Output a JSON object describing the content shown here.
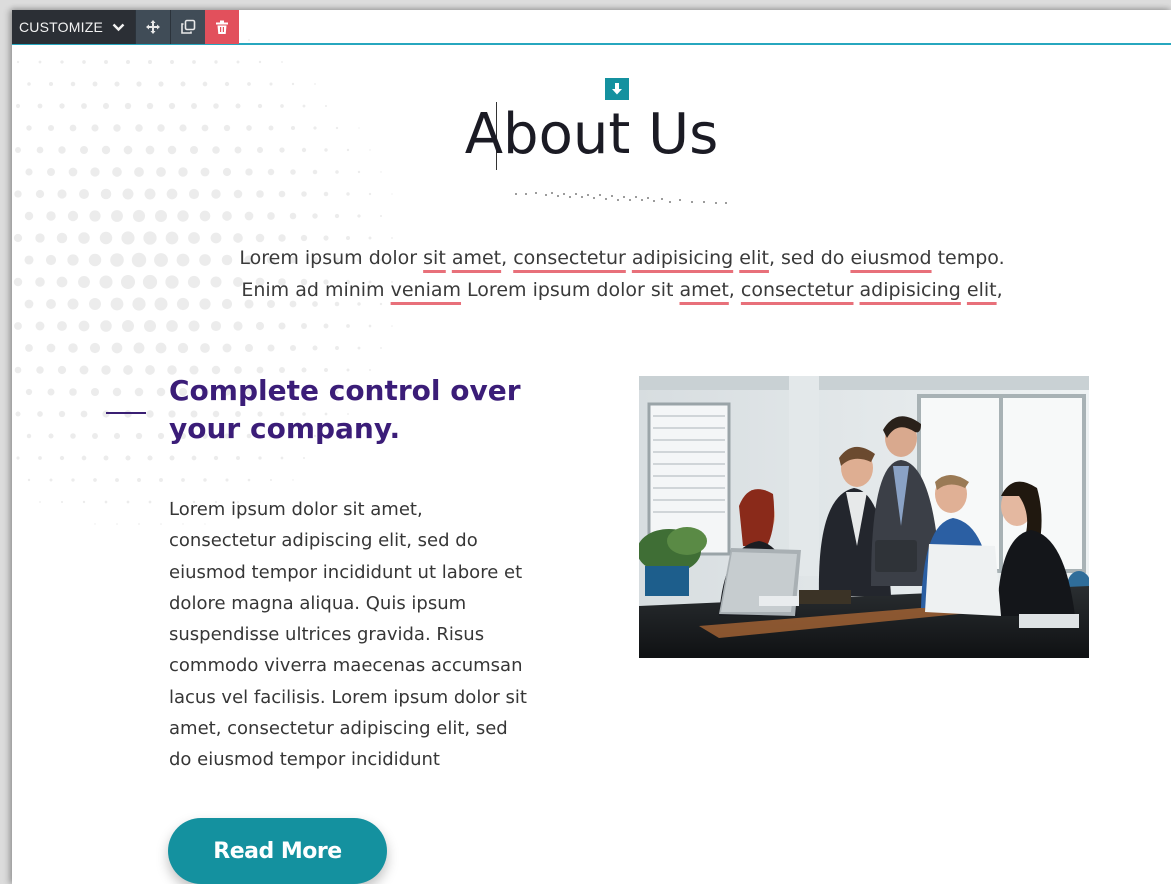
{
  "toolbar": {
    "customize_label": "CUSTOMIZE",
    "icons": [
      "chevron-down-icon",
      "move-icon",
      "duplicate-icon",
      "trash-icon"
    ]
  },
  "section": {
    "title": "About Us",
    "intro_line1": [
      {
        "t": "Lorem ipsum dolor ",
        "sp": false
      },
      {
        "t": "sit",
        "sp": true
      },
      {
        "t": " ",
        "sp": false
      },
      {
        "t": "amet",
        "sp": true
      },
      {
        "t": ", ",
        "sp": false
      },
      {
        "t": "consectetur",
        "sp": true
      },
      {
        "t": " ",
        "sp": false
      },
      {
        "t": "adipisicing",
        "sp": true
      },
      {
        "t": " ",
        "sp": false
      },
      {
        "t": "elit",
        "sp": true
      },
      {
        "t": ", sed do ",
        "sp": false
      },
      {
        "t": "eiusmod",
        "sp": true
      },
      {
        "t": " tempo.",
        "sp": false
      }
    ],
    "intro_line2": [
      {
        "t": "Enim ad minim ",
        "sp": false
      },
      {
        "t": "veniam",
        "sp": true
      },
      {
        "t": " Lorem ipsum dolor sit ",
        "sp": false
      },
      {
        "t": "amet",
        "sp": true
      },
      {
        "t": ", ",
        "sp": false
      },
      {
        "t": "consectetur",
        "sp": true
      },
      {
        "t": " ",
        "sp": false
      },
      {
        "t": "adipisicing",
        "sp": true
      },
      {
        "t": " ",
        "sp": false
      },
      {
        "t": "elit",
        "sp": true
      },
      {
        "t": ",",
        "sp": false
      }
    ]
  },
  "feature": {
    "heading_line1": "Complete control over",
    "heading_line2": "your company.",
    "body_lines": [
      "Lorem ipsum dolor sit amet,",
      "consectetur adipiscing elit, sed do",
      "eiusmod tempor incididunt ut labore et",
      "dolore magna aliqua. Quis ipsum",
      "suspendisse ultrices gravida. Risus",
      "commodo viverra maecenas accumsan",
      "lacus vel facilisis. Lorem ipsum dolor sit",
      "amet, consectetur adipiscing elit, sed",
      "do eiusmod tempor incididunt"
    ],
    "button_label": "Read More",
    "image_subject": "business-team-meeting-photo"
  },
  "colors": {
    "teal": "#14919f",
    "purple": "#3b1d78",
    "spell_underline": "#e8707a",
    "toolbar_dark": "#2b2f35",
    "delete_red": "#e2505c"
  }
}
